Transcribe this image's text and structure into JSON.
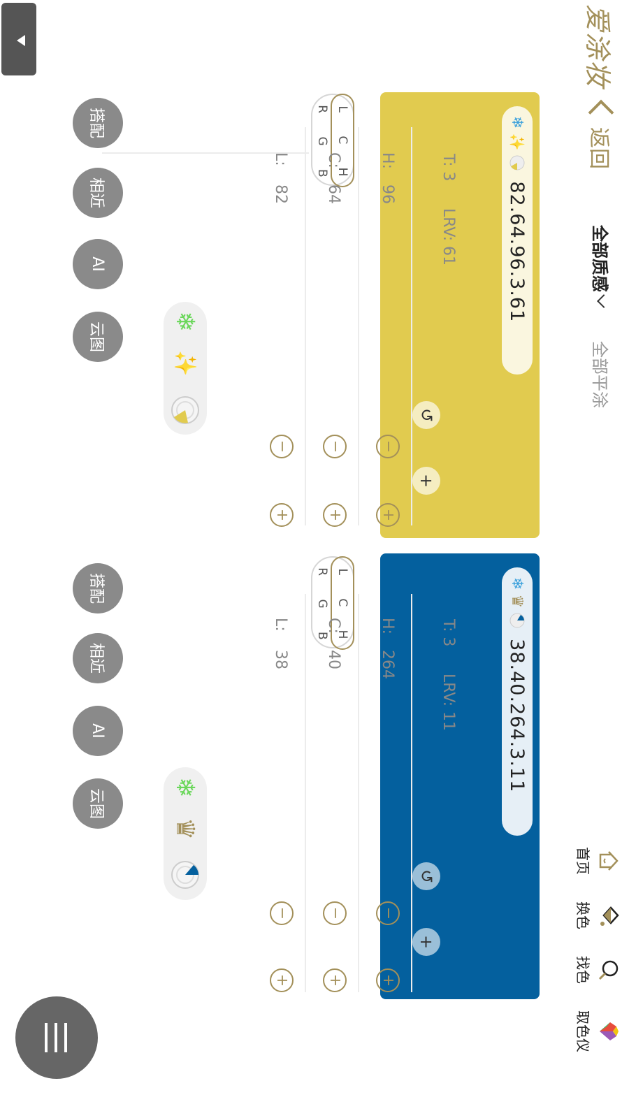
{
  "header": {
    "logo": "爱涂妆",
    "back_label": "返回",
    "filter_texture": "全部质感",
    "filter_finish": "全部平涂"
  },
  "nav": [
    {
      "label": "首页",
      "icon": "home-icon"
    },
    {
      "label": "换色",
      "icon": "paint-bucket-icon"
    },
    {
      "label": "找色",
      "icon": "search-icon"
    },
    {
      "label": "取色仪",
      "icon": "color-device-icon"
    }
  ],
  "colors": {
    "accent": "#a3905a",
    "gray_button": "#8a8a8a"
  },
  "panels": [
    {
      "swatch_color": "#e1cb4f",
      "code": "82.64.96.3.61",
      "icons": [
        "snowflake-icon",
        "sparkle-icon",
        "dial-icon"
      ],
      "mode_labels": {
        "line1": "L C H",
        "line2": "R G B"
      },
      "L_label": "L:",
      "L_value": "82",
      "C_label": "C:",
      "C_value": "64",
      "H_label": "H:",
      "H_value": "96",
      "T_text": "T: 3",
      "LRV_text": "LRV: 61",
      "effects": [
        "snowflake-icon",
        "sparkle-icon",
        "dial-icon"
      ],
      "buttons": [
        "搭配",
        "相近",
        "AI",
        "云图"
      ]
    },
    {
      "swatch_color": "#04609e",
      "code": "38.40.264.3.11",
      "icons": [
        "snowflake-icon",
        "crown-icon",
        "dial-icon"
      ],
      "mode_labels": {
        "line1": "L C H",
        "line2": "R G B"
      },
      "L_label": "L:",
      "L_value": "38",
      "C_label": "C:",
      "C_value": "40",
      "H_label": "H:",
      "H_value": "264",
      "T_text": "T: 3",
      "LRV_text": "LRV: 11",
      "effects": [
        "snowflake-icon",
        "crown-icon",
        "dial-icon"
      ],
      "buttons": [
        "搭配",
        "相近",
        "AI",
        "云图"
      ]
    }
  ]
}
